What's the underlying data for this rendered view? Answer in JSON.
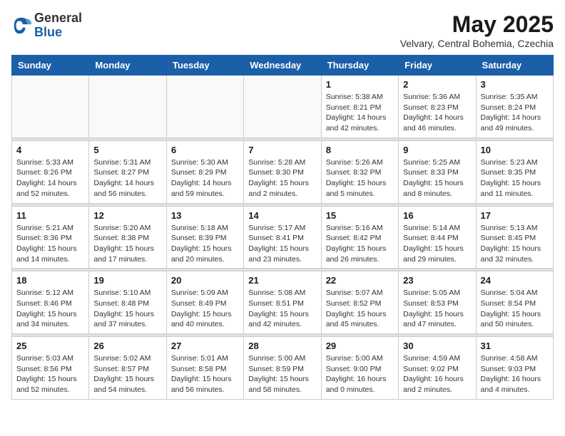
{
  "header": {
    "logo_general": "General",
    "logo_blue": "Blue",
    "month_title": "May 2025",
    "location": "Velvary, Central Bohemia, Czechia"
  },
  "days_of_week": [
    "Sunday",
    "Monday",
    "Tuesday",
    "Wednesday",
    "Thursday",
    "Friday",
    "Saturday"
  ],
  "weeks": [
    [
      {
        "day": "",
        "info": ""
      },
      {
        "day": "",
        "info": ""
      },
      {
        "day": "",
        "info": ""
      },
      {
        "day": "",
        "info": ""
      },
      {
        "day": "1",
        "info": "Sunrise: 5:38 AM\nSunset: 8:21 PM\nDaylight: 14 hours\nand 42 minutes."
      },
      {
        "day": "2",
        "info": "Sunrise: 5:36 AM\nSunset: 8:23 PM\nDaylight: 14 hours\nand 46 minutes."
      },
      {
        "day": "3",
        "info": "Sunrise: 5:35 AM\nSunset: 8:24 PM\nDaylight: 14 hours\nand 49 minutes."
      }
    ],
    [
      {
        "day": "4",
        "info": "Sunrise: 5:33 AM\nSunset: 8:26 PM\nDaylight: 14 hours\nand 52 minutes."
      },
      {
        "day": "5",
        "info": "Sunrise: 5:31 AM\nSunset: 8:27 PM\nDaylight: 14 hours\nand 56 minutes."
      },
      {
        "day": "6",
        "info": "Sunrise: 5:30 AM\nSunset: 8:29 PM\nDaylight: 14 hours\nand 59 minutes."
      },
      {
        "day": "7",
        "info": "Sunrise: 5:28 AM\nSunset: 8:30 PM\nDaylight: 15 hours\nand 2 minutes."
      },
      {
        "day": "8",
        "info": "Sunrise: 5:26 AM\nSunset: 8:32 PM\nDaylight: 15 hours\nand 5 minutes."
      },
      {
        "day": "9",
        "info": "Sunrise: 5:25 AM\nSunset: 8:33 PM\nDaylight: 15 hours\nand 8 minutes."
      },
      {
        "day": "10",
        "info": "Sunrise: 5:23 AM\nSunset: 8:35 PM\nDaylight: 15 hours\nand 11 minutes."
      }
    ],
    [
      {
        "day": "11",
        "info": "Sunrise: 5:21 AM\nSunset: 8:36 PM\nDaylight: 15 hours\nand 14 minutes."
      },
      {
        "day": "12",
        "info": "Sunrise: 5:20 AM\nSunset: 8:38 PM\nDaylight: 15 hours\nand 17 minutes."
      },
      {
        "day": "13",
        "info": "Sunrise: 5:18 AM\nSunset: 8:39 PM\nDaylight: 15 hours\nand 20 minutes."
      },
      {
        "day": "14",
        "info": "Sunrise: 5:17 AM\nSunset: 8:41 PM\nDaylight: 15 hours\nand 23 minutes."
      },
      {
        "day": "15",
        "info": "Sunrise: 5:16 AM\nSunset: 8:42 PM\nDaylight: 15 hours\nand 26 minutes."
      },
      {
        "day": "16",
        "info": "Sunrise: 5:14 AM\nSunset: 8:44 PM\nDaylight: 15 hours\nand 29 minutes."
      },
      {
        "day": "17",
        "info": "Sunrise: 5:13 AM\nSunset: 8:45 PM\nDaylight: 15 hours\nand 32 minutes."
      }
    ],
    [
      {
        "day": "18",
        "info": "Sunrise: 5:12 AM\nSunset: 8:46 PM\nDaylight: 15 hours\nand 34 minutes."
      },
      {
        "day": "19",
        "info": "Sunrise: 5:10 AM\nSunset: 8:48 PM\nDaylight: 15 hours\nand 37 minutes."
      },
      {
        "day": "20",
        "info": "Sunrise: 5:09 AM\nSunset: 8:49 PM\nDaylight: 15 hours\nand 40 minutes."
      },
      {
        "day": "21",
        "info": "Sunrise: 5:08 AM\nSunset: 8:51 PM\nDaylight: 15 hours\nand 42 minutes."
      },
      {
        "day": "22",
        "info": "Sunrise: 5:07 AM\nSunset: 8:52 PM\nDaylight: 15 hours\nand 45 minutes."
      },
      {
        "day": "23",
        "info": "Sunrise: 5:05 AM\nSunset: 8:53 PM\nDaylight: 15 hours\nand 47 minutes."
      },
      {
        "day": "24",
        "info": "Sunrise: 5:04 AM\nSunset: 8:54 PM\nDaylight: 15 hours\nand 50 minutes."
      }
    ],
    [
      {
        "day": "25",
        "info": "Sunrise: 5:03 AM\nSunset: 8:56 PM\nDaylight: 15 hours\nand 52 minutes."
      },
      {
        "day": "26",
        "info": "Sunrise: 5:02 AM\nSunset: 8:57 PM\nDaylight: 15 hours\nand 54 minutes."
      },
      {
        "day": "27",
        "info": "Sunrise: 5:01 AM\nSunset: 8:58 PM\nDaylight: 15 hours\nand 56 minutes."
      },
      {
        "day": "28",
        "info": "Sunrise: 5:00 AM\nSunset: 8:59 PM\nDaylight: 15 hours\nand 58 minutes."
      },
      {
        "day": "29",
        "info": "Sunrise: 5:00 AM\nSunset: 9:00 PM\nDaylight: 16 hours\nand 0 minutes."
      },
      {
        "day": "30",
        "info": "Sunrise: 4:59 AM\nSunset: 9:02 PM\nDaylight: 16 hours\nand 2 minutes."
      },
      {
        "day": "31",
        "info": "Sunrise: 4:58 AM\nSunset: 9:03 PM\nDaylight: 16 hours\nand 4 minutes."
      }
    ]
  ]
}
